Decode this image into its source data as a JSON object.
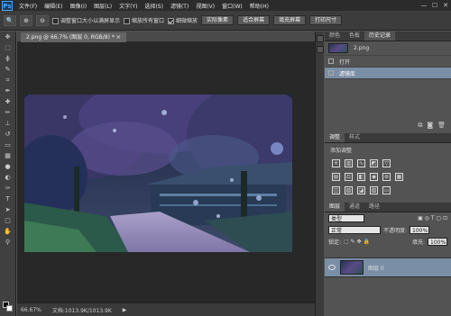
{
  "app": {
    "logo": "Ps"
  },
  "menu": [
    "文件(F)",
    "编辑(E)",
    "图像(I)",
    "图层(L)",
    "文字(Y)",
    "选择(S)",
    "滤镜(T)",
    "视图(V)",
    "窗口(W)",
    "帮助(H)"
  ],
  "window_controls": [
    "—",
    "☐",
    "✕"
  ],
  "options": {
    "resize_windows_label": "调整窗口大小以满屏显示",
    "resize_windows_checked": false,
    "zoom_all_label": "缩放所有窗口",
    "zoom_all_checked": false,
    "scrubby_zoom_label": "细微缩放",
    "scrubby_zoom_checked": true,
    "actual_pixels": "实际像素",
    "fit_screen": "适合屏幕",
    "fill_screen": "填充屏幕",
    "print_size": "打印尺寸"
  },
  "document": {
    "tab_title": "2.png @ 66.7% (图层 0, RGB/8) *",
    "tab_close": "×"
  },
  "status": {
    "zoom": "66.67%",
    "doc_size": "文档:1013.9K/1013.9K"
  },
  "history_panel": {
    "tabs": [
      "颜色",
      "色板",
      "历史记录"
    ],
    "snapshot": "2.png",
    "items": [
      "打开",
      "滤镜库"
    ],
    "selected_index": 1
  },
  "adjustments_panel": {
    "tabs": [
      "调整",
      "样式"
    ],
    "title": "添加调整"
  },
  "layers_panel": {
    "tabs": [
      "图层",
      "通道",
      "路径"
    ],
    "kind": "类型",
    "blend_mode": "正常",
    "opacity_label": "不透明度:",
    "opacity": "100%",
    "lock_label": "锁定:",
    "fill_label": "填充:",
    "fill": "100%",
    "layer_name": "图层 0"
  },
  "colors": {
    "ui_dark": "#2b2b2b",
    "panel": "#535353",
    "selected": "#7a8fa6"
  }
}
